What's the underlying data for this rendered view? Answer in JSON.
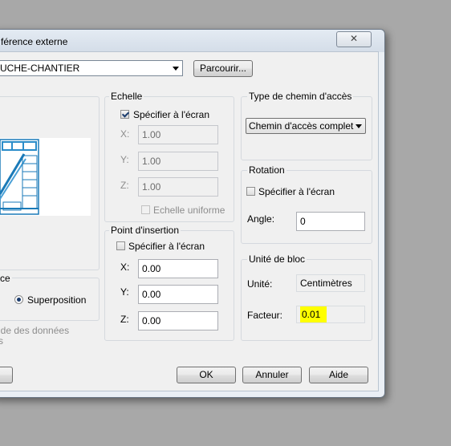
{
  "window": {
    "title": "férence externe",
    "close_glyph": "✕"
  },
  "name": {
    "value": "UCHE-CHANTIER"
  },
  "browse_label": "Parcourir...",
  "scale": {
    "label": "Echelle",
    "specify_label": "Spécifier à l'écran",
    "specify_checked": true,
    "x_label": "X:",
    "x_value": "1.00",
    "y_label": "Y:",
    "y_value": "1.00",
    "z_label": "Z:",
    "z_value": "1.00",
    "uniform_label": "Echelle uniforme"
  },
  "insertion": {
    "label": "Point d'insertion",
    "specify_label": "Spécifier à l'écran",
    "x_label": "X:",
    "x_value": "0.00",
    "y_label": "Y:",
    "y_value": "0.00",
    "z_label": "Z:",
    "z_value": "0.00"
  },
  "path_type": {
    "label": "Type de chemin d'accès",
    "value": "Chemin d'accès complet"
  },
  "rotation": {
    "label": "Rotation",
    "specify_label": "Spécifier à l'écran",
    "angle_label": "Angle:",
    "angle_value": "0"
  },
  "block_unit": {
    "label": "Unité de bloc",
    "unit_label": "Unité:",
    "unit_value": "Centimètres",
    "factor_label": "Facteur:",
    "factor_value": "0.01"
  },
  "reference_type": {
    "label_fragment": "ce",
    "overlay_label": "Superposition"
  },
  "path_note": {
    "line1": "ide des données",
    "line2": "s"
  },
  "buttons": {
    "ok": "OK",
    "cancel": "Annuler",
    "help": "Aide"
  },
  "colors": {
    "highlight": "#ffff00",
    "preview_blue": "#1a7ab8"
  }
}
